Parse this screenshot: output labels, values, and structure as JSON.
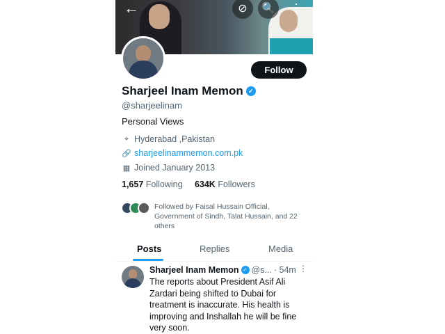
{
  "header": {
    "back_icon": "←",
    "grok_icon": "⊘",
    "search_icon": "🔍",
    "more_icon": "⋮"
  },
  "profile": {
    "follow_label": "Follow",
    "name": "Sharjeel Inam Memon",
    "verified_icon": "✓",
    "handle": "@sharjeelinam",
    "bio": "Personal Views",
    "location_icon": "⌖",
    "location": "Hyderabad ,Pakistan",
    "link_icon": "🔗",
    "website": "sharjeelinammemon.com.pk",
    "calendar_icon": "▦",
    "joined": "Joined January 2013",
    "following_count": "1,657",
    "following_label": "Following",
    "followers_count": "634K",
    "followers_label": "Followers",
    "followed_by": "Followed by Faisal Hussain Official, Government of Sindh, Talat Hussain, and 22 others"
  },
  "tabs": [
    "Posts",
    "Replies",
    "Media"
  ],
  "tweet": {
    "name": "Sharjeel Inam Memon",
    "handle": "@s...",
    "time": "· 54m",
    "more": "⋮",
    "text": "The reports about President Asif Ali Zardari being shifted to Dubai for treatment is inaccurate. His health is improving and Inshallah he will be fine very soon."
  },
  "colors": {
    "accent": "#1d9bf0",
    "text_primary": "#0f1419",
    "text_secondary": "#536471",
    "follow_button": "#0f1419"
  }
}
